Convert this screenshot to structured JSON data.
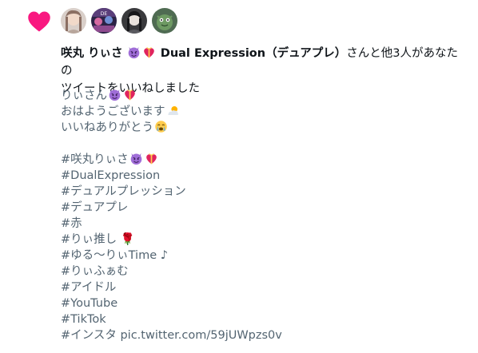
{
  "colors": {
    "heart": "#f91880",
    "text": "#0f1419",
    "secondary": "#536471"
  },
  "notification": {
    "user1": "咲丸 りぃさ",
    "user2": "Dual Expression（デュアプレ）",
    "suffix": "さんと他3人があなたの",
    "line2": "ツイートをいいねしました",
    "avatars": [
      "avatar-1",
      "avatar-2",
      "avatar-3",
      "avatar-4"
    ]
  },
  "tweet": {
    "l1": "りぃさん",
    "l2": "おはようございます",
    "l3": "いいねありがとう",
    "tag1": "#咲丸りぃさ",
    "tag2": "#DualExpression",
    "tag3": "#デュアルプレッション",
    "tag4": "#デュアプレ",
    "tag5": "#赤",
    "tag6": "#りぃ推し",
    "tag6_emoji": "🌹",
    "tag7": "#ゆる〜りぃTime",
    "tag7_suffix": "♪",
    "tag8": "#りぃふぁむ",
    "tag9": "#アイドル",
    "tag10": "#YouTube",
    "tag11": "#TikTok",
    "tag12": "#インスタ",
    "link": "pic.twitter.com/59jUWpzs0v"
  }
}
